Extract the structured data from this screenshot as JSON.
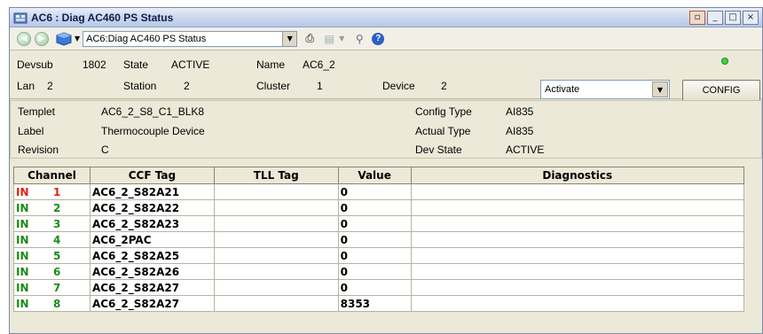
{
  "window": {
    "title": "AC6 : Diag AC460 PS Status",
    "controls": {
      "restore": "▫",
      "minimize": "_",
      "maximize": "□",
      "close": "×"
    }
  },
  "toolbar": {
    "address": "AC6:Diag AC460 PS Status",
    "icons": [
      "back-icon",
      "forward-icon",
      "cube-icon",
      "print-icon",
      "document-icon",
      "pin-icon",
      "help-icon"
    ]
  },
  "header": {
    "devsub_label": "Devsub",
    "devsub_value": "1802",
    "state_label": "State",
    "state_value": "ACTIVE",
    "name_label": "Name",
    "name_value": "AC6_2",
    "lan_label": "Lan",
    "lan_value": "2",
    "station_label": "Station",
    "station_value": "2",
    "cluster_label": "Cluster",
    "cluster_value": "1",
    "device_label": "Device",
    "device_value": "2",
    "status_led_color": "#3fd04f",
    "action_select": "Activate",
    "config_button": "CONFIG"
  },
  "details": {
    "templet_label": "Templet",
    "templet_value": "AC6_2_S8_C1_BLK8",
    "label_label": "Label",
    "label_value": "Thermocouple Device",
    "revision_label": "Revision",
    "revision_value": "C",
    "config_type_label": "Config Type",
    "config_type_value": "AI835",
    "actual_type_label": "Actual Type",
    "actual_type_value": "AI835",
    "dev_state_label": "Dev State",
    "dev_state_value": "ACTIVE"
  },
  "table": {
    "columns": [
      "Channel",
      "CCF Tag",
      "TLL Tag",
      "Value",
      "Diagnostics"
    ],
    "rows": [
      {
        "io": "IN",
        "ch": "1",
        "ccf": "AC6_2_S82A21",
        "tll": "",
        "value": "0",
        "diag": "",
        "color": "#e02010"
      },
      {
        "io": "IN",
        "ch": "2",
        "ccf": "AC6_2_S82A22",
        "tll": "",
        "value": "0",
        "diag": "",
        "color": "#1a8a1a"
      },
      {
        "io": "IN",
        "ch": "3",
        "ccf": "AC6_2_S82A23",
        "tll": "",
        "value": "0",
        "diag": "",
        "color": "#1a8a1a"
      },
      {
        "io": "IN",
        "ch": "4",
        "ccf": "AC6_2PAC",
        "tll": "",
        "value": "0",
        "diag": "",
        "color": "#1a8a1a"
      },
      {
        "io": "IN",
        "ch": "5",
        "ccf": "AC6_2_S82A25",
        "tll": "",
        "value": "0",
        "diag": "",
        "color": "#1a8a1a"
      },
      {
        "io": "IN",
        "ch": "6",
        "ccf": "AC6_2_S82A26",
        "tll": "",
        "value": "0",
        "diag": "",
        "color": "#1a8a1a"
      },
      {
        "io": "IN",
        "ch": "7",
        "ccf": "AC6_2_S82A27",
        "tll": "",
        "value": "0",
        "diag": "",
        "color": "#1a8a1a"
      },
      {
        "io": "IN",
        "ch": "8",
        "ccf": "AC6_2_S82A27",
        "tll": "",
        "value": "8353",
        "diag": "",
        "color": "#1a8a1a"
      }
    ]
  }
}
